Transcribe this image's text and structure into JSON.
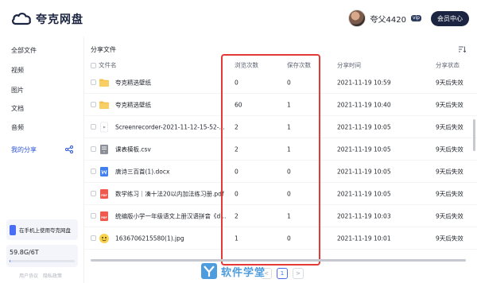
{
  "app": {
    "name": "夸克网盘"
  },
  "user": {
    "name": "夸父4420",
    "tag": "vip",
    "member_button": "会员中心"
  },
  "sidebar": {
    "items": [
      {
        "label": "全部文件"
      },
      {
        "label": "视频"
      },
      {
        "label": "图片"
      },
      {
        "label": "文档"
      },
      {
        "label": "音频"
      },
      {
        "label": "我的分享",
        "active": true
      }
    ],
    "promo": "在手机上使用夸克网盘",
    "storage": {
      "text": "59.8G/6T",
      "used_fraction": 0.01
    },
    "footer": [
      "用户协议",
      "隐私政策"
    ]
  },
  "main": {
    "title": "分享文件",
    "columns": {
      "name": "文件名",
      "views": "浏览次数",
      "saves": "保存次数",
      "time": "分享时间",
      "status": "分享状态"
    },
    "rows": [
      {
        "name": "夸克精选壁纸",
        "type": "folder",
        "views": "0",
        "saves": "0",
        "time": "2021-11-19 10:59",
        "status": "9天后失效"
      },
      {
        "name": "夸克精选壁纸",
        "type": "folder",
        "views": "60",
        "saves": "1",
        "time": "2021-11-19 10:40",
        "status": "9天后失效"
      },
      {
        "name": "Screenrecorder-2021-11-12-15-52-...",
        "type": "video",
        "views": "2",
        "saves": "1",
        "time": "2021-11-19 10:05",
        "status": "9天后失效"
      },
      {
        "name": "课表模板.csv",
        "type": "csv",
        "views": "2",
        "saves": "1",
        "time": "2021-11-19 10:05",
        "status": "9天后失效"
      },
      {
        "name": "唐诗三百首(1).docx",
        "type": "doc",
        "views": "0",
        "saves": "0",
        "time": "2021-11-19 10:05",
        "status": "9天后失效"
      },
      {
        "name": "数学练习｜凑十法20以内加法练习册.pdf",
        "type": "pdf",
        "views": "0",
        "saves": "0",
        "time": "2021-11-19 10:05",
        "status": "9天后失效"
      },
      {
        "name": "统编版小学一年级语文上册汉语拼音《d...",
        "type": "pdf",
        "views": "2",
        "saves": "1",
        "time": "2021-11-19 10:03",
        "status": "9天后失效"
      },
      {
        "name": "1636706215580(1).jpg",
        "type": "image",
        "views": "1",
        "saves": "0",
        "time": "2021-11-19 10:01",
        "status": "9天后失效"
      }
    ]
  },
  "pagination": {
    "prev": "<",
    "current": "1",
    "next": ">"
  },
  "watermark": {
    "text": "软件学堂"
  },
  "colors": {
    "accent": "#2f56d6",
    "brand_dark": "#1b2440",
    "highlight": "#e53935"
  }
}
